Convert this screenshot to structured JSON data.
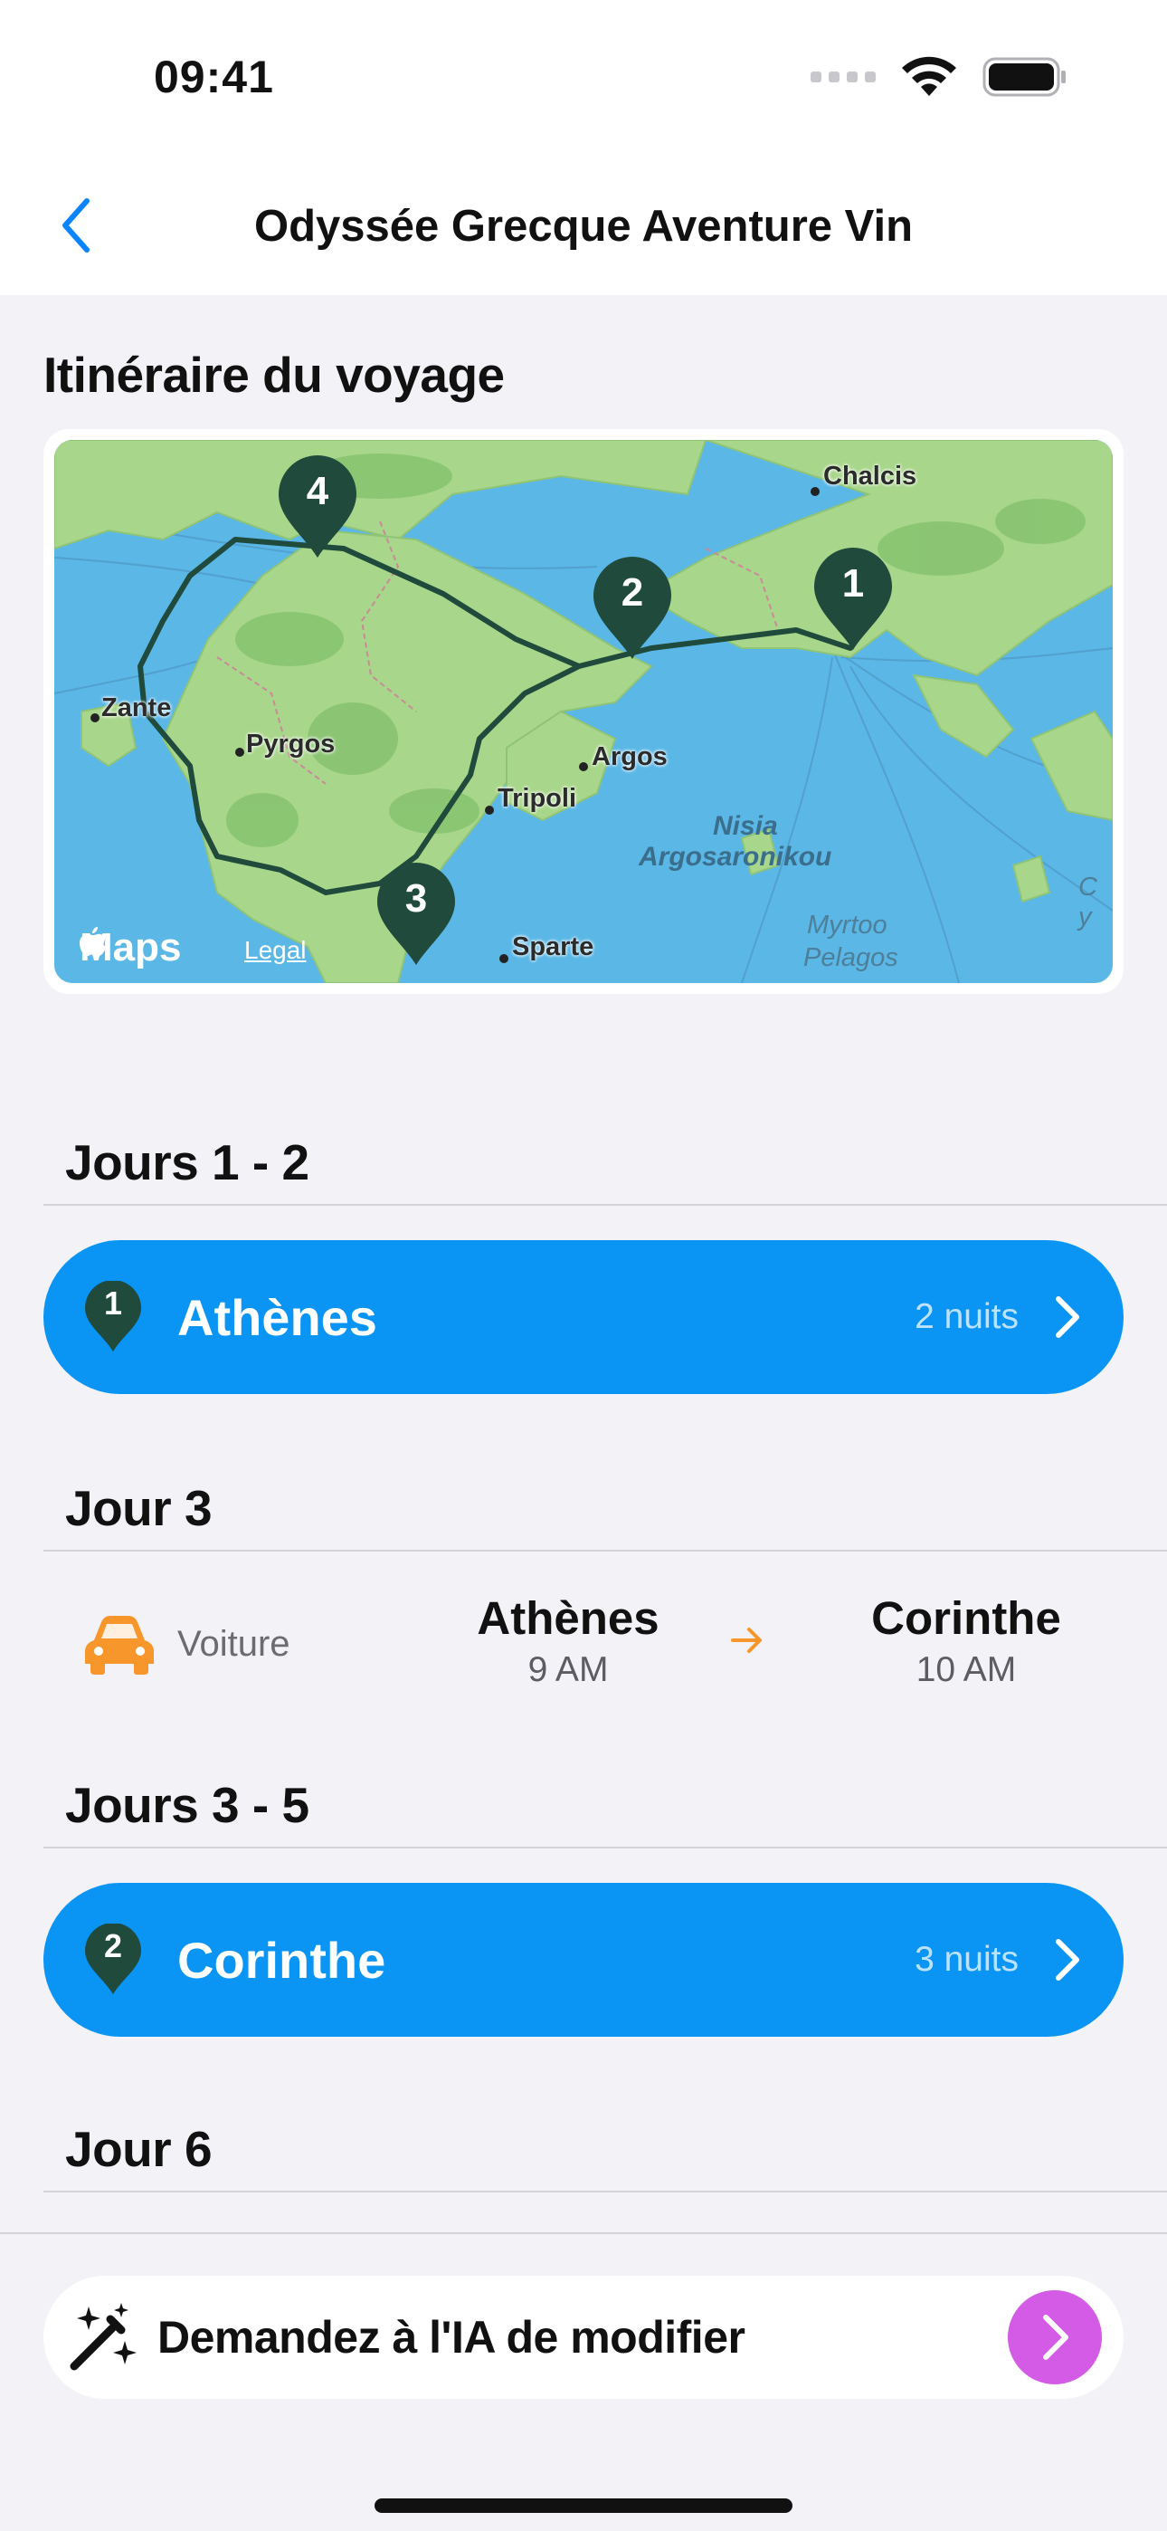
{
  "status": {
    "time": "09:41"
  },
  "nav": {
    "title": "Odyssée Grecque Aventure Vin",
    "back_icon": "chevron-left-icon"
  },
  "itinerary": {
    "title": "Itinéraire du voyage"
  },
  "map": {
    "labels": {
      "chalcis": "Chalcis",
      "zante": "Zante",
      "pyrgos": "Pyrgos",
      "argos": "Argos",
      "tripoli": "Tripoli",
      "nisia": "Nisia",
      "argosaronikou": "Argosaronikou",
      "sparte": "Sparte",
      "myrtoo": "Myrtoo",
      "pelagos": "Pelagos",
      "edge": "C y"
    },
    "brand": "Maps",
    "legal": "Legal",
    "pins": [
      "1",
      "2",
      "3",
      "4"
    ]
  },
  "segments": {
    "s1": {
      "header": "Jours 1 - 2",
      "pin": "1",
      "city": "Athènes",
      "nights": "2 nuits"
    },
    "s2": {
      "header": "Jour 3",
      "mode": "Voiture",
      "from_city": "Athènes",
      "from_time": "9 AM",
      "to_city": "Corinthe",
      "to_time": "10 AM"
    },
    "s3": {
      "header": "Jours 3 - 5",
      "pin": "2",
      "city": "Corinthe",
      "nights": "3 nuits"
    },
    "s4": {
      "header": "Jour 6"
    }
  },
  "ai": {
    "label": "Demandez à l'IA de modifier"
  },
  "colors": {
    "accent_blue": "#0a94f4",
    "pin_green": "#1f4a3c",
    "ai_purple": "#d35be6",
    "car_orange": "#f7962b"
  }
}
